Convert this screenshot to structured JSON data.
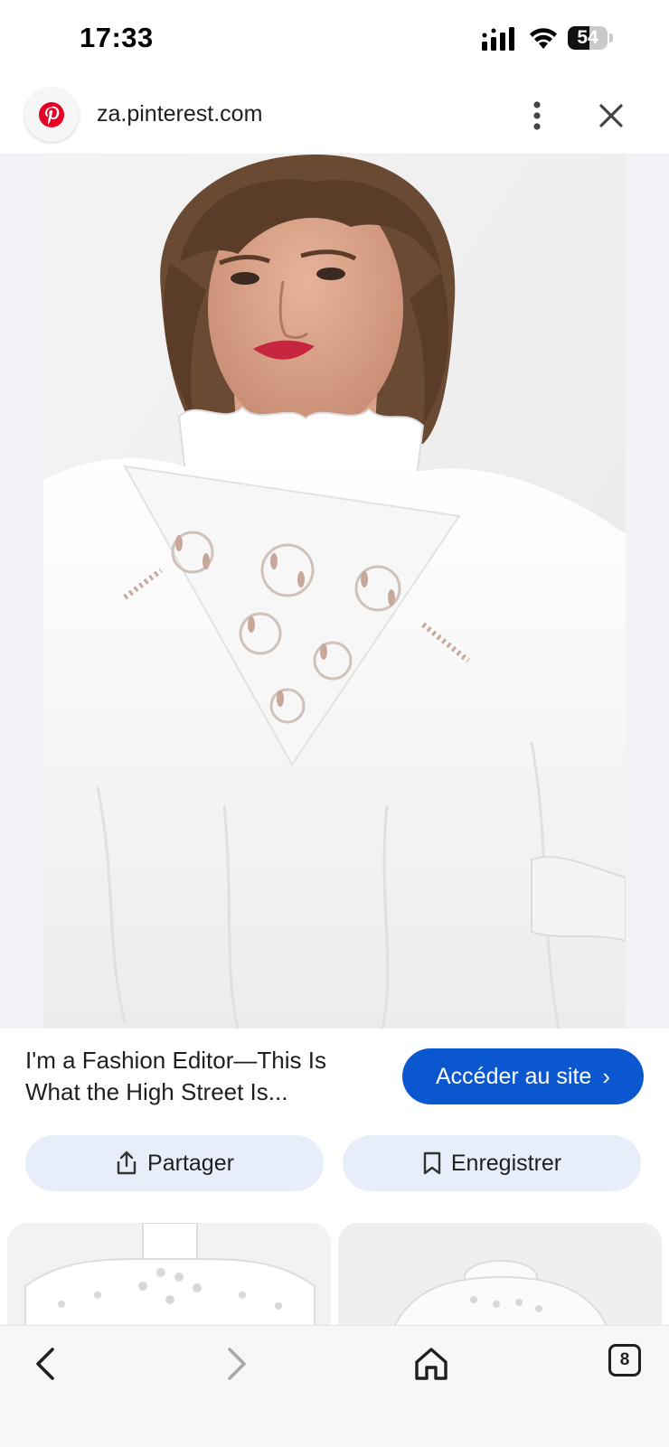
{
  "status_bar": {
    "time": "17:33",
    "battery_level": "54"
  },
  "browser": {
    "url": "za.pinterest.com",
    "favicon": "pinterest-logo",
    "menu_icon": "more-vert-icon",
    "close_icon": "close-icon"
  },
  "hero": {
    "image": "model-white-eyelet-blouse"
  },
  "result": {
    "title": "I'm a Fashion Editor—This Is What the High Street Is...",
    "visit_label": "Accéder au site",
    "visit_chevron": "›",
    "share_label": "Partager",
    "save_label": "Enregistrer"
  },
  "related": {
    "thumbnails": [
      "white-eyelet-blouse-ruffle-sleeves",
      "white-blouse-front"
    ]
  },
  "bottom_nav": {
    "tab_count": "8"
  },
  "colors": {
    "accent": "#0b57d0",
    "chip_bg": "#e8eef9",
    "pinterest_red": "#e60023"
  }
}
